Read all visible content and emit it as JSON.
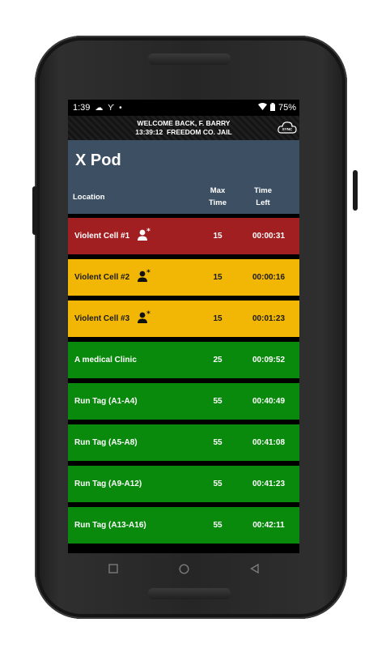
{
  "status_bar": {
    "time": "1:39",
    "battery": "75%"
  },
  "welcome": {
    "line1": "WELCOME BACK, F. BARRY",
    "clock": "13:39:12",
    "facility": "FREEDOM CO. JAIL",
    "sync_label": "SYNC"
  },
  "pod": {
    "title": "X Pod",
    "columns": {
      "location": "Location",
      "max_time_line1": "Max",
      "max_time_line2": "Time",
      "time_left_line1": "Time",
      "time_left_line2": "Left"
    }
  },
  "rows": [
    {
      "location": "Violent Cell #1",
      "max_time": "15",
      "time_left": "00:00:31",
      "status_color": "#a21f21",
      "has_inmate_icon": true
    },
    {
      "location": "Violent Cell #2",
      "max_time": "15",
      "time_left": "00:00:16",
      "status_color": "#f2b705",
      "has_inmate_icon": true
    },
    {
      "location": "Violent Cell #3",
      "max_time": "15",
      "time_left": "00:01:23",
      "status_color": "#f2b705",
      "has_inmate_icon": true
    },
    {
      "location": "A medical Clinic",
      "max_time": "25",
      "time_left": "00:09:52",
      "status_color": "#0a8a0d",
      "has_inmate_icon": false
    },
    {
      "location": "Run Tag (A1-A4)",
      "max_time": "55",
      "time_left": "00:40:49",
      "status_color": "#0a8a0d",
      "has_inmate_icon": false
    },
    {
      "location": "Run Tag (A5-A8)",
      "max_time": "55",
      "time_left": "00:41:08",
      "status_color": "#0a8a0d",
      "has_inmate_icon": false
    },
    {
      "location": "Run Tag (A9-A12)",
      "max_time": "55",
      "time_left": "00:41:23",
      "status_color": "#0a8a0d",
      "has_inmate_icon": false
    },
    {
      "location": "Run Tag (A13-A16)",
      "max_time": "55",
      "time_left": "00:42:11",
      "status_color": "#0a8a0d",
      "has_inmate_icon": false
    }
  ]
}
